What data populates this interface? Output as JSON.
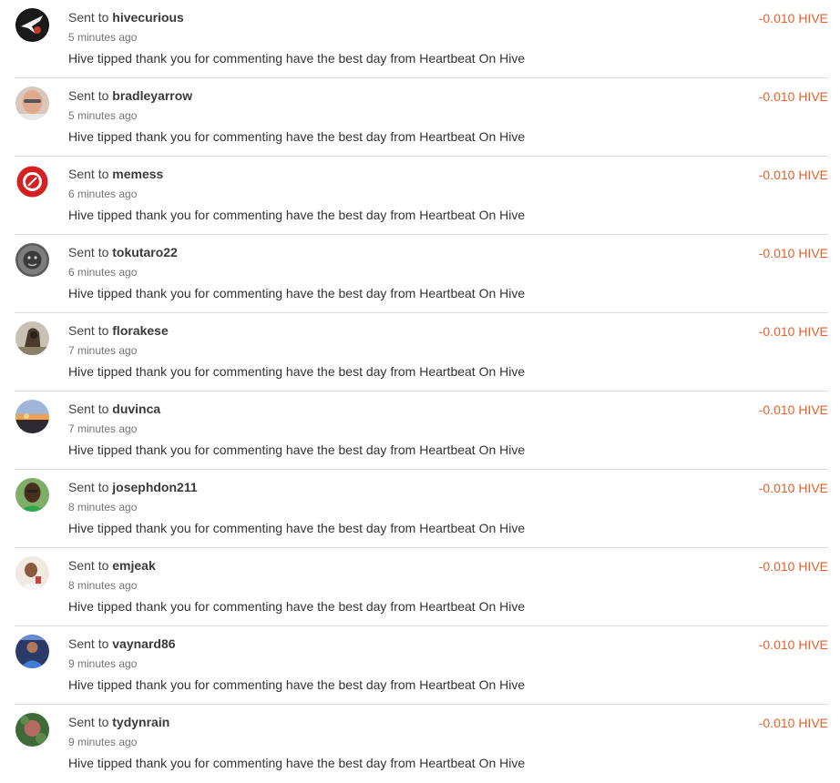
{
  "colors": {
    "amount": "#e9602b",
    "divider": "#dcdcdc",
    "text": "#333333",
    "muted": "#757575"
  },
  "transfers": [
    {
      "prefix": "Sent to",
      "user": "hivecurious",
      "time": "5 minutes ago",
      "memo": "Hive tipped thank you for commenting have the best day from Heartbeat On Hive",
      "amount": "-0.010 HIVE",
      "avatar_icon": "hivecurious-avatar"
    },
    {
      "prefix": "Sent to",
      "user": "bradleyarrow",
      "time": "5 minutes ago",
      "memo": "Hive tipped thank you for commenting have the best day from Heartbeat On Hive",
      "amount": "-0.010 HIVE",
      "avatar_icon": "bradleyarrow-avatar"
    },
    {
      "prefix": "Sent to",
      "user": "memess",
      "time": "6 minutes ago",
      "memo": "Hive tipped thank you for commenting have the best day from Heartbeat On Hive",
      "amount": "-0.010 HIVE",
      "avatar_icon": "memess-avatar"
    },
    {
      "prefix": "Sent to",
      "user": "tokutaro22",
      "time": "6 minutes ago",
      "memo": "Hive tipped thank you for commenting have the best day from Heartbeat On Hive",
      "amount": "-0.010 HIVE",
      "avatar_icon": "tokutaro22-avatar"
    },
    {
      "prefix": "Sent to",
      "user": "florakese",
      "time": "7 minutes ago",
      "memo": "Hive tipped thank you for commenting have the best day from Heartbeat On Hive",
      "amount": "-0.010 HIVE",
      "avatar_icon": "florakese-avatar"
    },
    {
      "prefix": "Sent to",
      "user": "duvinca",
      "time": "7 minutes ago",
      "memo": "Hive tipped thank you for commenting have the best day from Heartbeat On Hive",
      "amount": "-0.010 HIVE",
      "avatar_icon": "duvinca-avatar"
    },
    {
      "prefix": "Sent to",
      "user": "josephdon211",
      "time": "8 minutes ago",
      "memo": "Hive tipped thank you for commenting have the best day from Heartbeat On Hive",
      "amount": "-0.010 HIVE",
      "avatar_icon": "josephdon211-avatar"
    },
    {
      "prefix": "Sent to",
      "user": "emjeak",
      "time": "8 minutes ago",
      "memo": "Hive tipped thank you for commenting have the best day from Heartbeat On Hive",
      "amount": "-0.010 HIVE",
      "avatar_icon": "emjeak-avatar"
    },
    {
      "prefix": "Sent to",
      "user": "vaynard86",
      "time": "9 minutes ago",
      "memo": "Hive tipped thank you for commenting have the best day from Heartbeat On Hive",
      "amount": "-0.010 HIVE",
      "avatar_icon": "vaynard86-avatar"
    },
    {
      "prefix": "Sent to",
      "user": "tydynrain",
      "time": "9 minutes ago",
      "memo": "Hive tipped thank you for commenting have the best day from Heartbeat On Hive",
      "amount": "-0.010 HIVE",
      "avatar_icon": "tydynrain-avatar"
    }
  ]
}
